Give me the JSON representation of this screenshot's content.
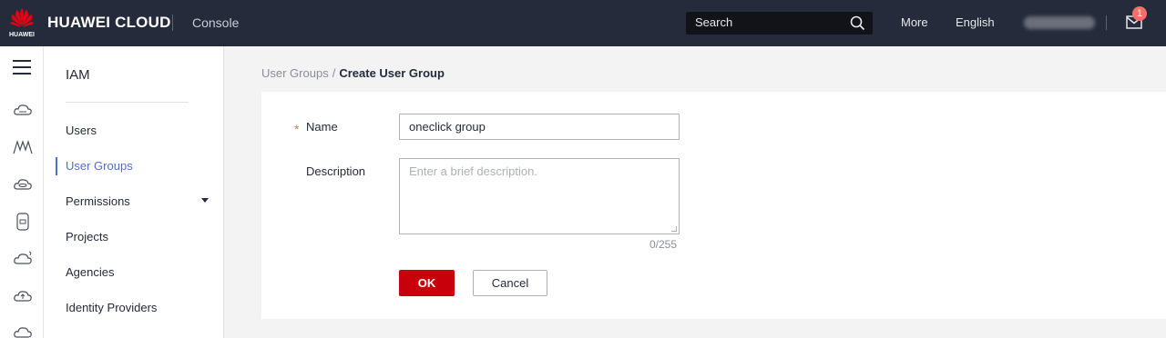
{
  "topbar": {
    "logo_text": "HUAWEI",
    "brand": "HUAWEI CLOUD",
    "console": "Console",
    "search_placeholder": "Search",
    "more": "More",
    "language": "English",
    "notification_count": "1"
  },
  "rail": {
    "icons": [
      "menu-icon",
      "cloud-server-icon",
      "network-icon",
      "cloud-storage-icon",
      "database-icon",
      "cloud-sync-icon",
      "cloud-upload-icon",
      "cloud-settings-icon"
    ]
  },
  "sidebar": {
    "title": "IAM",
    "items": [
      {
        "label": "Users"
      },
      {
        "label": "User Groups"
      },
      {
        "label": "Permissions"
      },
      {
        "label": "Projects"
      },
      {
        "label": "Agencies"
      },
      {
        "label": "Identity Providers"
      }
    ]
  },
  "breadcrumb": {
    "parent": "User Groups",
    "separator": "/",
    "current": "Create User Group"
  },
  "form": {
    "name_label": "Name",
    "required_mark": "*",
    "name_value": "oneclick group",
    "description_label": "Description",
    "description_placeholder": "Enter a brief description.",
    "char_counter": "0/255",
    "ok_label": "OK",
    "cancel_label": "Cancel"
  },
  "colors": {
    "topbar": "#252b3a",
    "primary_button": "#c7000b",
    "active_nav": "#526ecc",
    "badge": "#f66f6a"
  }
}
